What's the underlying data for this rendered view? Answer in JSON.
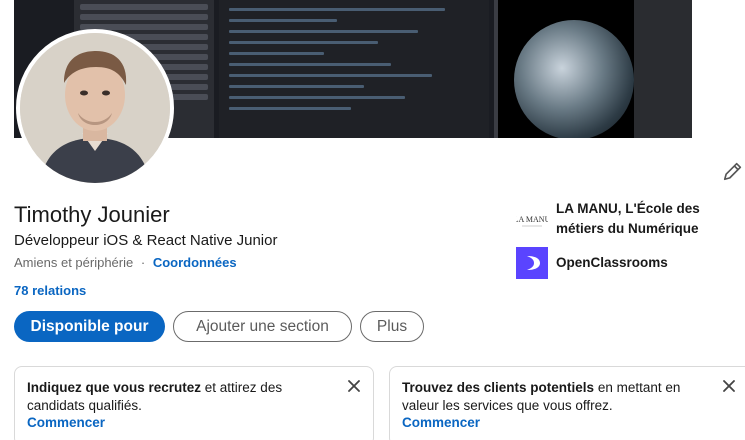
{
  "profile": {
    "name": "Timothy Jounier",
    "headline": "Développeur iOS & React Native Junior",
    "location": "Amiens et périphérie",
    "separator": "·",
    "contact_link": "Coordonnées",
    "connections": "78 relations"
  },
  "education": [
    {
      "name": "LA MANU, L'École des métiers du Numérique",
      "logo_text": "LA MANU",
      "icon": "la-manu-logo"
    },
    {
      "name": "OpenClassrooms",
      "icon": "openclassrooms-logo",
      "color": "#5a44ff"
    }
  ],
  "actions": {
    "primary": "Disponible pour",
    "add_section": "Ajouter une section",
    "more": "Plus"
  },
  "cards": [
    {
      "bold": "Indiquez que vous recrutez",
      "text": " et attirez des candidats qualifiés.",
      "link": "Commencer"
    },
    {
      "bold": "Trouvez des clients potentiels",
      "text": " en mettant en valeur les services que vous offrez.",
      "link": "Commencer"
    }
  ],
  "icons": {
    "edit": "pencil-icon",
    "close": "close-icon"
  },
  "colors": {
    "accent": "#0a66c2",
    "text": "#000000e6",
    "muted": "#00000099"
  }
}
